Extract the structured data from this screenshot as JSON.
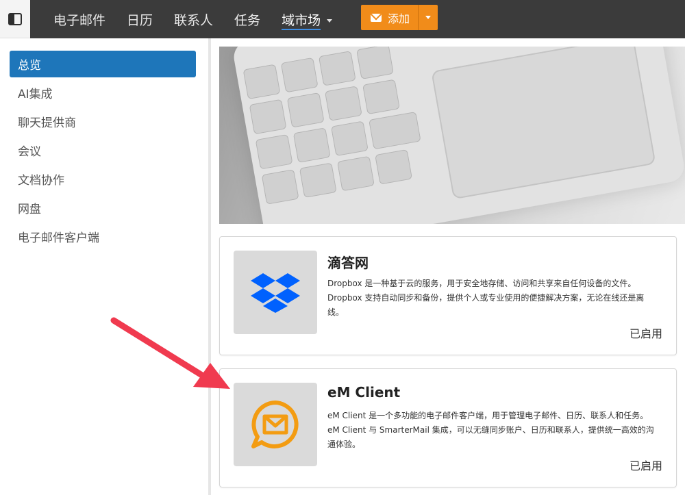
{
  "topbar": {
    "nav": [
      {
        "label": "电子邮件"
      },
      {
        "label": "日历"
      },
      {
        "label": "联系人"
      },
      {
        "label": "任务"
      },
      {
        "label": "域市场"
      }
    ],
    "add_button": {
      "label": "添加"
    }
  },
  "sidebar": {
    "items": [
      {
        "label": "总览"
      },
      {
        "label": "AI集成"
      },
      {
        "label": "聊天提供商"
      },
      {
        "label": "会议"
      },
      {
        "label": "文档协作"
      },
      {
        "label": "网盘"
      },
      {
        "label": "电子邮件客户端"
      }
    ]
  },
  "cards": [
    {
      "title": "滴答网",
      "description": "Dropbox 是一种基于云的服务，用于安全地存储、访问和共享来自任何设备的文件。Dropbox 支持自动同步和备份，提供个人或专业使用的便捷解决方案，无论在线还是离线。",
      "status": "已启用",
      "icon": "dropbox-icon",
      "color": "#0061fe"
    },
    {
      "title": "eM Client",
      "description": "eM Client 是一个多功能的电子邮件客户端，用于管理电子邮件、日历、联系人和任务。eM Client 与 SmarterMail 集成，可以无缝同步账户、日历和联系人，提供统一高效的沟通体验。",
      "status": "已启用",
      "icon": "em-client-icon",
      "color": "#f39c12"
    }
  ],
  "colors": {
    "topbar": "#3b3b3b",
    "accent_orange": "#f18c1a",
    "selected_blue": "#1e76ba",
    "annotation_arrow": "#f03a4f"
  }
}
